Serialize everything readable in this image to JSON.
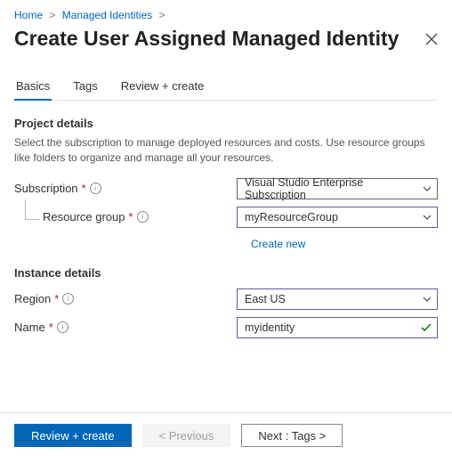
{
  "breadcrumb": {
    "home": "Home",
    "managed_identities": "Managed Identities"
  },
  "title": "Create User Assigned Managed Identity",
  "tabs": {
    "basics": "Basics",
    "tags": "Tags",
    "review": "Review + create"
  },
  "project_details": {
    "heading": "Project details",
    "description": "Select the subscription to manage deployed resources and costs. Use resource groups like folders to organize and manage all your resources.",
    "subscription_label": "Subscription",
    "subscription_value": "Visual Studio Enterprise Subscription",
    "resource_group_label": "Resource group",
    "resource_group_value": "myResourceGroup",
    "create_new": "Create new"
  },
  "instance_details": {
    "heading": "Instance details",
    "region_label": "Region",
    "region_value": "East US",
    "name_label": "Name",
    "name_value": "myidentity"
  },
  "footer": {
    "review_create": "Review + create",
    "previous": "< Previous",
    "next": "Next : Tags >"
  }
}
